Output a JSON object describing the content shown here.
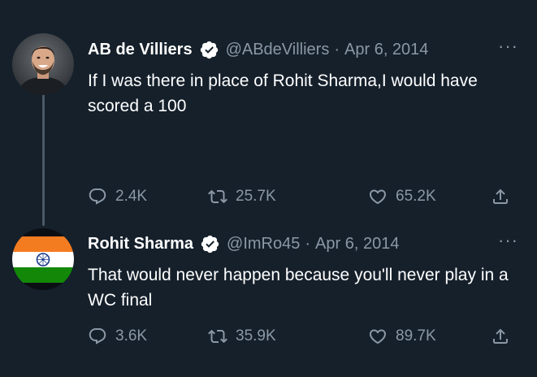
{
  "tweets": [
    {
      "name": "AB de Villiers",
      "handle": "@ABdeVilliers",
      "separator": "·",
      "date": "Apr 6, 2014",
      "text": "If I was there in place of Rohit Sharma,I would have scored a 100",
      "more": "···",
      "avatar": "ab-de-villiers-photo",
      "replies": "2.4K",
      "retweets": "25.7K",
      "likes": "65.2K"
    },
    {
      "name": "Rohit Sharma",
      "handle": "@ImRo45",
      "separator": "·",
      "date": "Apr 6, 2014",
      "text": "That would never happen because you'll never play in a WC final",
      "more": "···",
      "avatar": "india-flag",
      "replies": "3.6K",
      "retweets": "35.9K",
      "likes": "89.7K"
    }
  ],
  "icons": {
    "reply": "reply-icon",
    "retweet": "retweet-icon",
    "like": "heart-icon",
    "share": "share-icon",
    "verified": "verified-badge-icon"
  },
  "colors": {
    "background": "#15202b",
    "primary_text": "#ffffff",
    "secondary_text": "#8b98a5",
    "thread_line": "#4b5a66",
    "flag_saffron": "#f47c20",
    "flag_green": "#138808",
    "flag_chakra": "#1a3a8a"
  }
}
